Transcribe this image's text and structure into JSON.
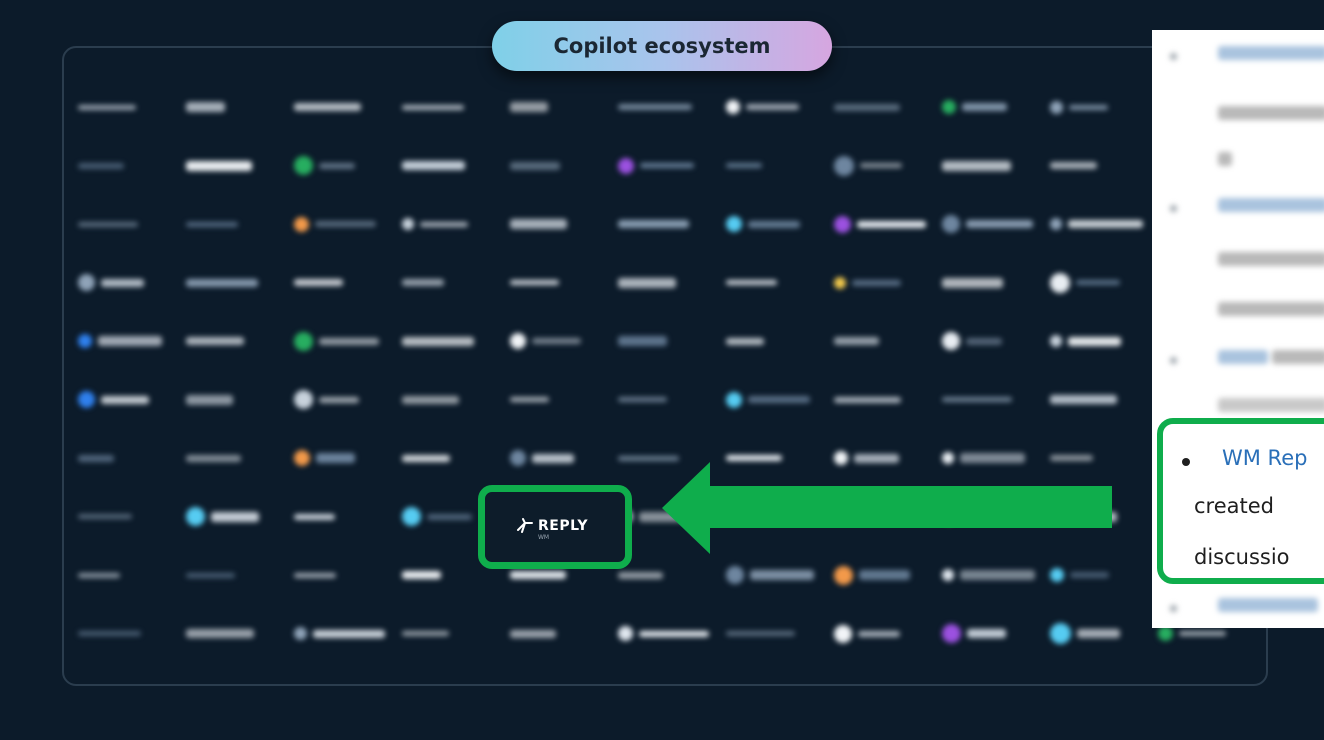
{
  "ecosystem": {
    "title": "Copilot ecosystem",
    "highlighted_logo": {
      "name": "REPLY",
      "sub": "WM"
    }
  },
  "document": {
    "highlighted_item": {
      "link_text": "WM Rep",
      "line2": "created",
      "line3": "discussio"
    }
  },
  "colors": {
    "background": "#0c1b2a",
    "accent_green": "#0fad4c",
    "link_blue": "#2a6fb8"
  }
}
